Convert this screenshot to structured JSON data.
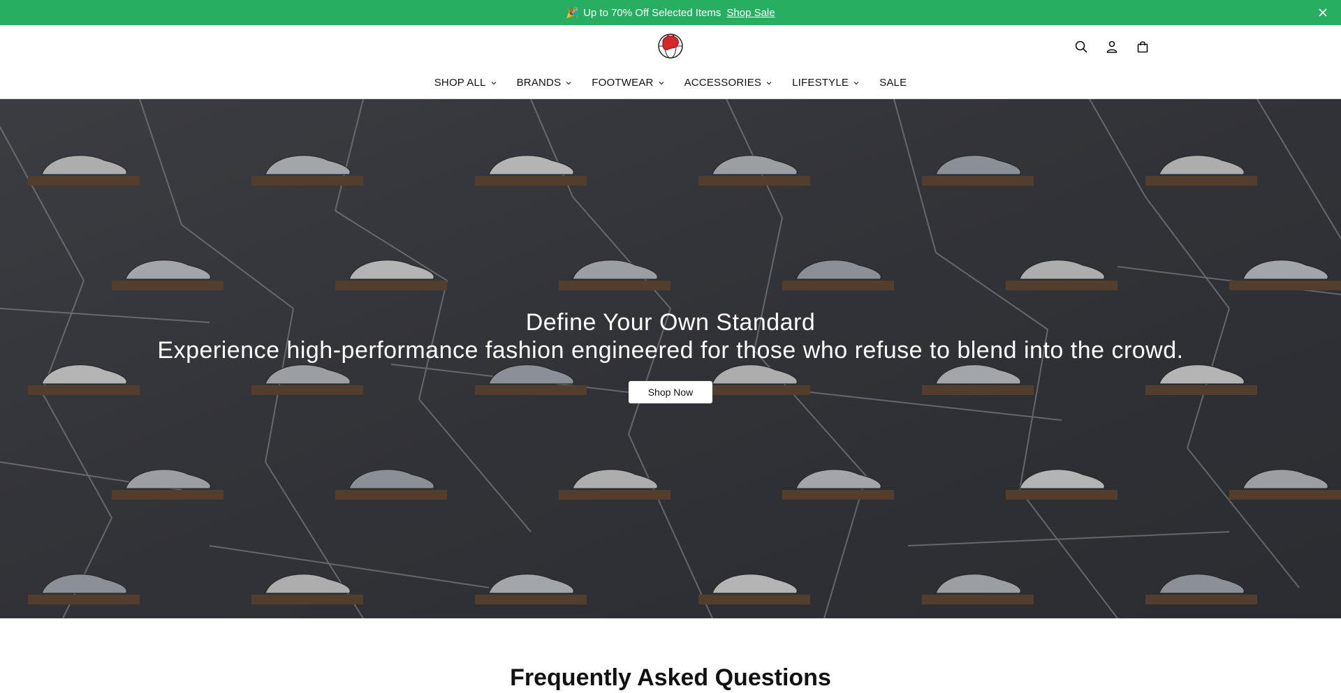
{
  "announcement": {
    "emoji": "🎉",
    "text": "Up to 70% Off Selected Items",
    "link": "Shop Sale"
  },
  "header": {
    "icons": [
      "search-icon",
      "user-icon",
      "bag-icon"
    ]
  },
  "nav": {
    "items": [
      {
        "label": "SHOP ALL",
        "has_dropdown": true
      },
      {
        "label": "BRANDS",
        "has_dropdown": true
      },
      {
        "label": "FOOTWEAR",
        "has_dropdown": true
      },
      {
        "label": "ACCESSORIES",
        "has_dropdown": true
      },
      {
        "label": "LIFESTYLE",
        "has_dropdown": true
      },
      {
        "label": "SALE",
        "has_dropdown": false
      }
    ]
  },
  "hero": {
    "title": "Define Your Own Standard",
    "subtitle": "Experience high-performance fashion engineered for those who refuse to blend into the crowd.",
    "button": "Shop Now"
  },
  "faq": {
    "title": "Frequently Asked Questions"
  },
  "colors": {
    "announcement_bg": "#27ae60",
    "text": "#111111",
    "hero_wall": "#3b3d42"
  }
}
